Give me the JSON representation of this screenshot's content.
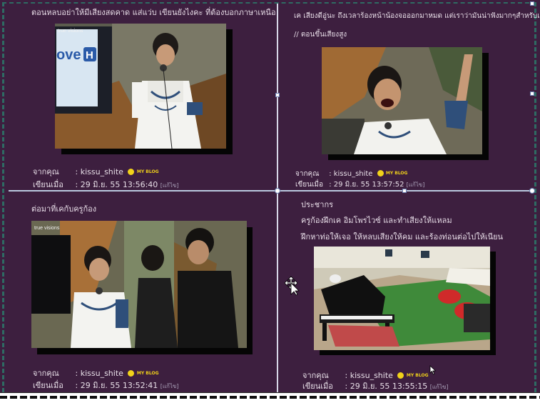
{
  "posts": [
    {
      "text_lines": [
        "ตอนหลบอย่าให้มีเสียงสดคาด แส่แว่บ เขียนยังไงคะ ที่ต้องบอกภาษาเหนือ"
      ],
      "from_label": "จากคุณ",
      "user": ": kissu_shite",
      "written_label": "เขียนเมื่อ",
      "date": ": 29 มิ.ย. 55 13:56:40",
      "edit": "[แก้ไข]",
      "photo": {
        "brand": "true visions",
        "ad_text": "ove",
        "ad_badge": "H"
      }
    },
    {
      "text_lines": [
        "เค เสียงดีอู่นะ ถึงเวลาร้องหน้าน้องจอออกมาหมด แต่เราว่ามันน่าฟังมากๆสำหรับเสียง",
        "// ตอนขึ้นเสียงสูง"
      ],
      "from_label": "จากคุณ",
      "user": ": kissu_shite",
      "written_label": "เขียนเมื่อ",
      "date": ": 29 มิ.ย. 55 13:57:52",
      "edit": "[แก้ไข]"
    },
    {
      "text_lines": [
        "ต่อมาที่เคกับครูก้อง"
      ],
      "from_label": "จากคุณ",
      "user": ": kissu_shite",
      "written_label": "เขียนเมื่อ",
      "date": ": 29 มิ.ย. 55 13:52:41",
      "edit": "[แก้ไข]",
      "photo": {
        "brand": "true visions"
      }
    },
    {
      "text_lines": [
        "ประชากร",
        "ครูก้องฝึกเค อิมโพรไวซ์ และทำเสียงให้แหลม",
        "ฝึกหาท่อให้เจอ ให้หลบเสียงให้คม และร้องท่อนต่อไปให้เนียน"
      ],
      "from_label": "จากคุณ",
      "user": ": kissu_shite",
      "written_label": "เขียนเมื่อ",
      "date": ": 29 มิ.ย. 55 13:55:15",
      "edit": "[แก้ไข]"
    }
  ],
  "myblog_label": "MY BLOG",
  "colors": {
    "background": "#3d1f3f",
    "text": "#e6dbe6",
    "accent": "#f1d21a",
    "border": "#2e6b63"
  }
}
